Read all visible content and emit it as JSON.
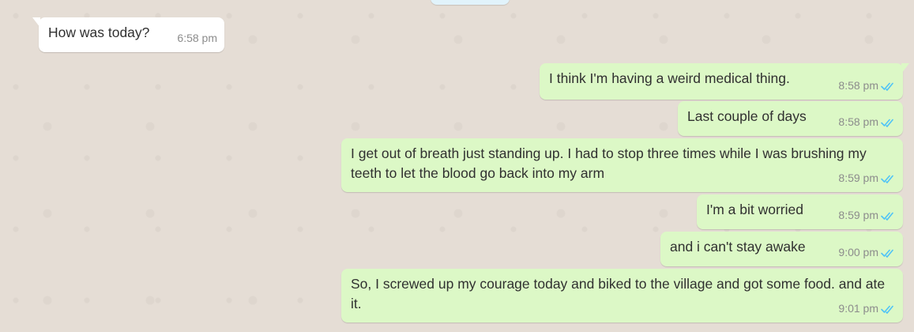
{
  "messages": [
    {
      "direction": "in",
      "text": "How was today?",
      "time": "6:58 pm"
    },
    {
      "direction": "out",
      "text": "I think I'm having a weird medical thing.",
      "time": "8:58 pm",
      "status": "read"
    },
    {
      "direction": "out",
      "text": "Last couple of days",
      "time": "8:58 pm",
      "status": "read"
    },
    {
      "direction": "out",
      "text": "I get out of breath just standing up. I had to stop three times while I was brushing my teeth to let the blood go back into my arm",
      "time": "8:59 pm",
      "status": "read"
    },
    {
      "direction": "out",
      "text": "I'm a bit worried",
      "time": "8:59 pm",
      "status": "read"
    },
    {
      "direction": "out",
      "text": "and i can't stay awake",
      "time": "9:00 pm",
      "status": "read"
    },
    {
      "direction": "out",
      "text": "So, I screwed up my courage today and biked to the village and got some food. and ate it.",
      "time": "9:01 pm",
      "status": "read"
    }
  ],
  "colors": {
    "background": "#e5ddd5",
    "incoming_bubble": "#ffffff",
    "outgoing_bubble": "#dcf8c6",
    "read_ticks": "#4fc3f7",
    "timestamp": "#8c8c8c"
  },
  "icons": {
    "read_receipt": "double-check-icon"
  }
}
